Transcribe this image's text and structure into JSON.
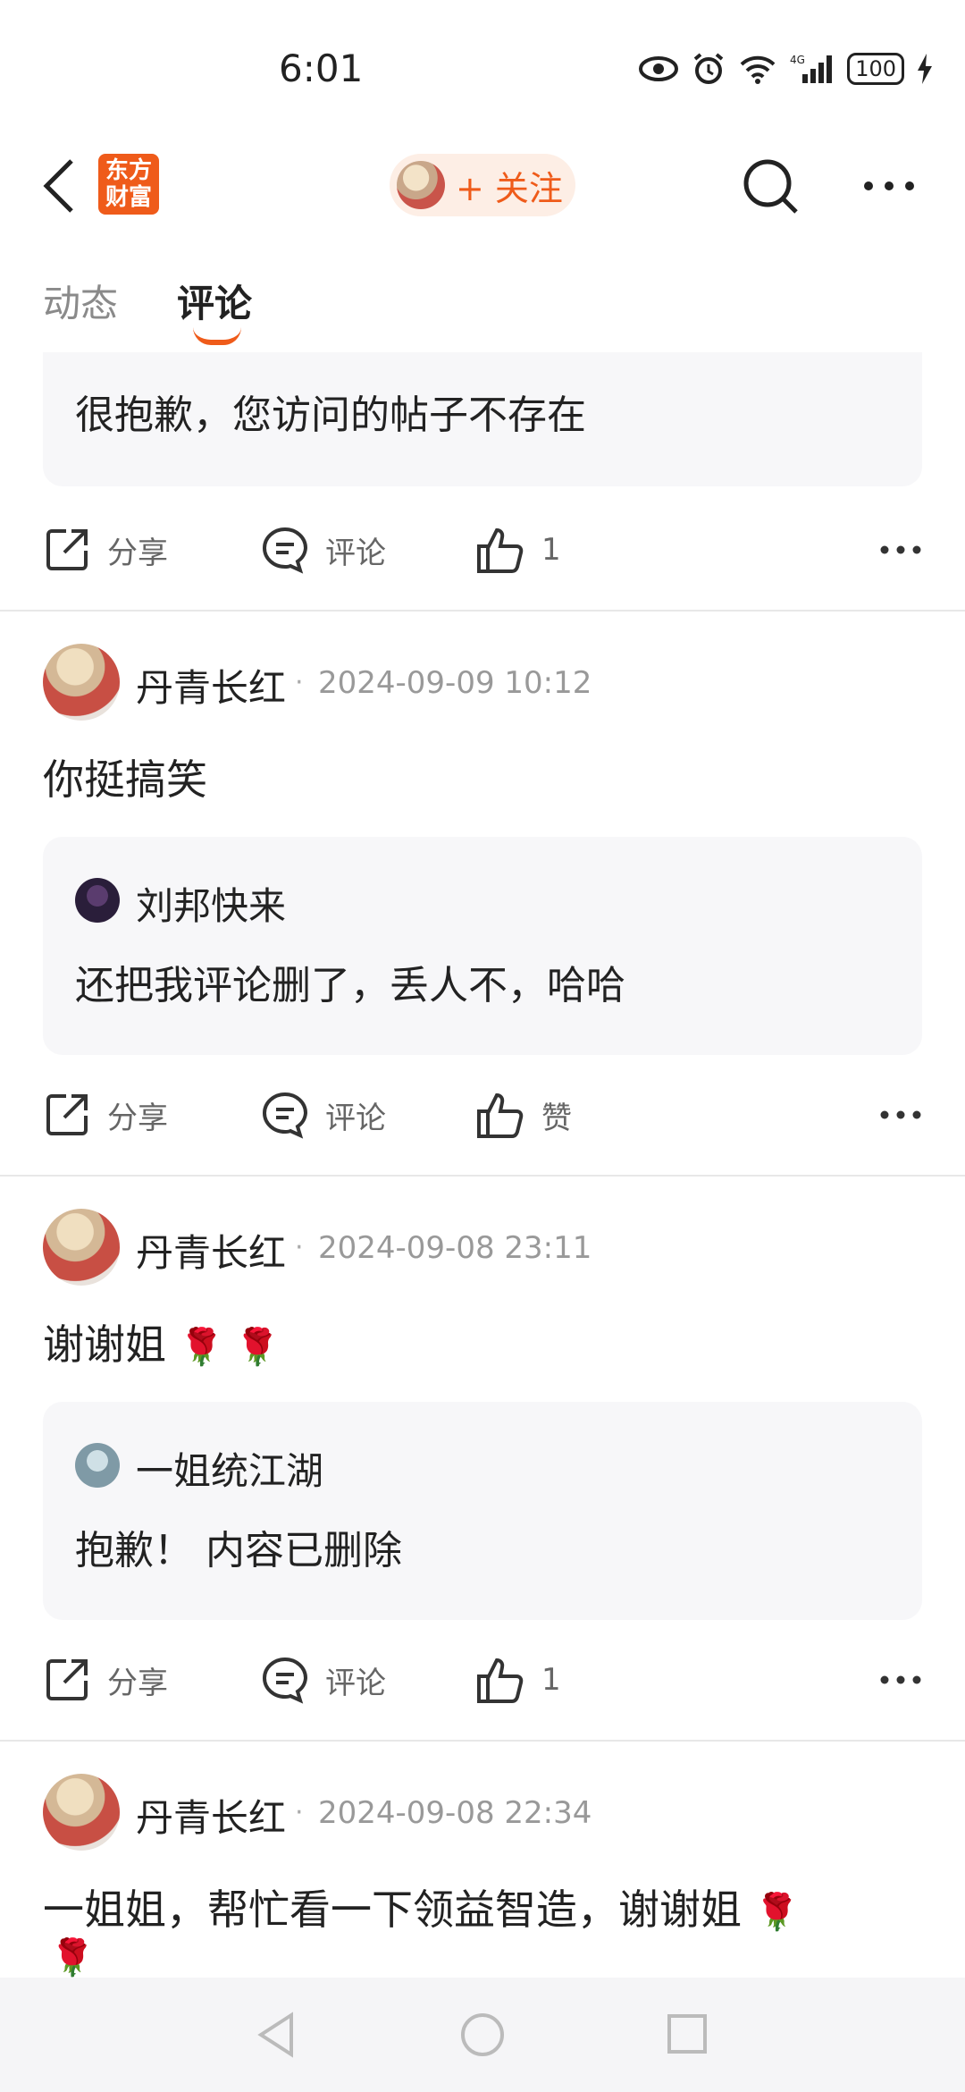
{
  "status_bar": {
    "time": "6:01",
    "battery": "100"
  },
  "header": {
    "logo_line1": "东方",
    "logo_line2": "财富",
    "follow_label": "+ 关注"
  },
  "tabs": [
    {
      "label": "动态"
    },
    {
      "label": "评论"
    }
  ],
  "top_fragment": {
    "quote_text": "很抱歉，您访问的帖子不存在",
    "actions": {
      "share": "分享",
      "comment": "评论",
      "like": "1"
    }
  },
  "posts": [
    {
      "author": "丹青长红",
      "datetime": "2024-09-09 10:12",
      "text": "你挺搞笑",
      "reply_author": "刘邦快来",
      "reply_text": "还把我评论删了，丢人不，哈哈",
      "actions": {
        "share": "分享",
        "comment": "评论",
        "like": "赞"
      }
    },
    {
      "author": "丹青长红",
      "datetime": "2024-09-08 23:11",
      "text": "谢谢姐",
      "text_emoji": "🌹 🌹",
      "reply_author": "一姐统江湖",
      "reply_text": "抱歉！ 内容已删除",
      "actions": {
        "share": "分享",
        "comment": "评论",
        "like": "1"
      }
    },
    {
      "author": "丹青长红",
      "datetime": "2024-09-08 22:34",
      "text": "一姐姐，帮忙看一下领益智造，谢谢姐",
      "text_emoji": "🌹",
      "text_emoji2": "🌹"
    }
  ],
  "colors": {
    "accent": "#ef5b1a",
    "quote_bg": "#f7f7f9",
    "divider": "#e8e8e8"
  },
  "icons": [
    "back-icon",
    "search-icon",
    "more-icon",
    "share-icon",
    "comment-icon",
    "like-icon"
  ]
}
